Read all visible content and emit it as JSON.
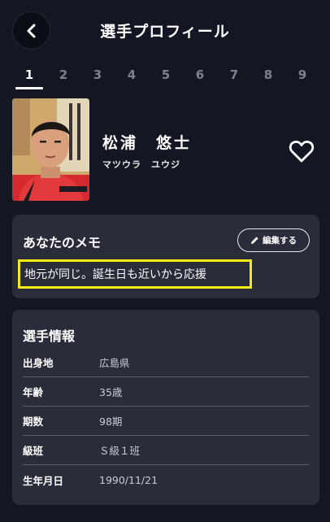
{
  "header": {
    "title": "選手プロフィール",
    "back_icon": "chevron-left-icon"
  },
  "tabs": [
    {
      "label": "1",
      "active": true
    },
    {
      "label": "2",
      "active": false
    },
    {
      "label": "3",
      "active": false
    },
    {
      "label": "4",
      "active": false
    },
    {
      "label": "5",
      "active": false
    },
    {
      "label": "6",
      "active": false
    },
    {
      "label": "7",
      "active": false
    },
    {
      "label": "8",
      "active": false
    },
    {
      "label": "9",
      "active": false
    }
  ],
  "profile": {
    "name": "松浦　悠士",
    "kana": "マツウラ　ユウジ",
    "favorite_icon": "heart-outline-icon"
  },
  "memo": {
    "title": "あなたのメモ",
    "edit_label": "編集する",
    "text": "地元が同じ。誕生日も近いから応援",
    "highlight_color": "#f4ea14"
  },
  "info": {
    "title": "選手情報",
    "rows": [
      {
        "key": "出身地",
        "value": "広島県"
      },
      {
        "key": "年齢",
        "value": "35歳"
      },
      {
        "key": "期数",
        "value": "98期"
      },
      {
        "key": "級班",
        "value": "Ｓ級１班"
      },
      {
        "key": "生年月日",
        "value": "1990/11/21"
      }
    ]
  },
  "colors": {
    "background": "#141721",
    "card": "#2a2d39",
    "accent": "#ffffff"
  }
}
